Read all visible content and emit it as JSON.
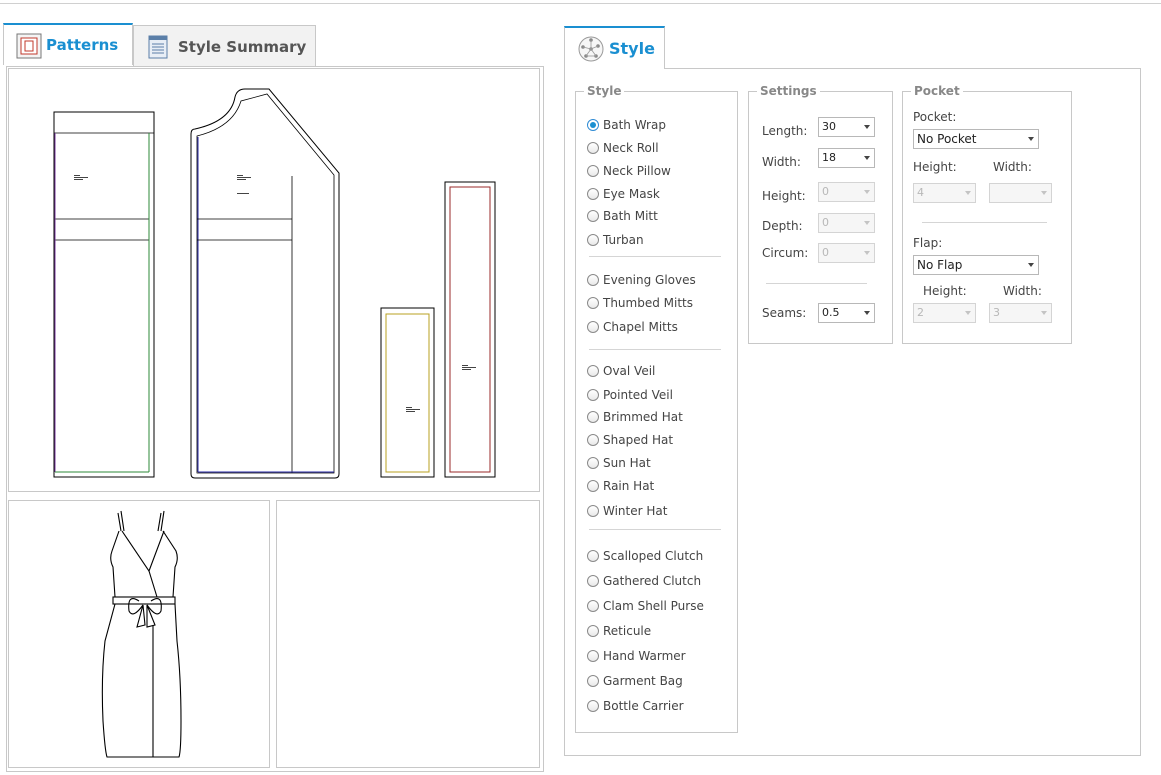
{
  "left_tabs": {
    "patterns": "Patterns",
    "style_summary": "Style Summary"
  },
  "right_tab": {
    "style": "Style"
  },
  "style_group": {
    "legend": "Style",
    "options": [
      "Bath Wrap",
      "Neck Roll",
      "Neck Pillow",
      "Eye Mask",
      "Bath Mitt",
      "Turban",
      "Evening Gloves",
      "Thumbed Mitts",
      "Chapel Mitts",
      "Oval Veil",
      "Pointed Veil",
      "Brimmed Hat",
      "Shaped Hat",
      "Sun Hat",
      "Rain Hat",
      "Winter Hat",
      "Scalloped Clutch",
      "Gathered Clutch",
      "Clam Shell Purse",
      "Reticule",
      "Hand Warmer",
      "Garment Bag",
      "Bottle Carrier"
    ],
    "selected": "Bath Wrap"
  },
  "settings": {
    "legend": "Settings",
    "length_label": "Length:",
    "length_value": "30",
    "width_label": "Width:",
    "width_value": "18",
    "height_label": "Height:",
    "height_value": "0",
    "depth_label": "Depth:",
    "depth_value": "0",
    "circum_label": "Circum:",
    "circum_value": "0",
    "seams_label": "Seams:",
    "seams_value": "0.5"
  },
  "pocket": {
    "legend": "Pocket",
    "pocket_label": "Pocket:",
    "pocket_value": "No Pocket",
    "height_label": "Height:",
    "height_value": "4",
    "width_label": "Width:",
    "width_value": "",
    "flap_label": "Flap:",
    "flap_value": "No Flap",
    "flap_height_label": "Height:",
    "flap_height_value": "2",
    "flap_width_label": "Width:",
    "flap_width_value": "3"
  },
  "colors": {
    "accent": "#1a8fd1",
    "border": "#c8c8c8",
    "piece_purple": "#7a3aa0",
    "piece_green": "#2e8a3a",
    "piece_blue": "#2a2aa8",
    "piece_gold": "#b8a020",
    "piece_red": "#9a2a2a"
  },
  "icons": {
    "patterns_tab": "pattern-icon",
    "summary_tab": "document-icon",
    "style_tab": "network-globe-icon"
  }
}
